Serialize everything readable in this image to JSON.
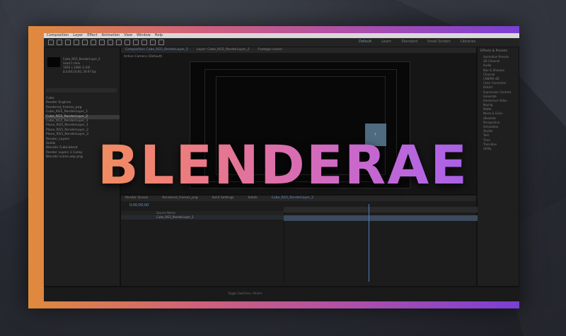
{
  "title": "BLENDERAE",
  "menubar": [
    "Composition",
    "Layer",
    "Effect",
    "Animation",
    "View",
    "Window",
    "Help"
  ],
  "workspaces": [
    "Default",
    "Learn",
    "Standard",
    "Small Screen",
    "Libraries"
  ],
  "project_panel": {
    "comp_name": "Cube_RG5_RenderLayer_2",
    "info_lines": [
      "Used 1 time",
      "1920 x 1080 (1.00)",
      "Δ 0;00;10;00, 29.97 fps"
    ],
    "items": [
      "Cube",
      "Render Engines",
      "Rendered_frames_png",
      "Cube_RG5_RenderLayer_1",
      "Cube_RG5_RenderLayer_2",
      "Cube_RG5_RenderLayer_3",
      "Plane_RG5_RenderLayer_1",
      "Plane_RG5_RenderLayer_2",
      "Plane_RG5_RenderLayer_3",
      "Render_Layers",
      "Solids",
      "Blender Cube.blend",
      "Render Layers 1 Comp",
      "Blender scene.aep.png"
    ],
    "selected_index": 4
  },
  "viewer": {
    "tabs": [
      "Composition Cube_RG5_RenderLayer_2",
      "Layer: Cube_RG5_RenderLayer_2",
      "Footage (none)"
    ],
    "active_tab": 0,
    "camera": "Active Camera (Default)"
  },
  "effects_panel": {
    "header": "Effects & Presets",
    "items": [
      "Animation Presets",
      "3D Channel",
      "Audio",
      "Blur & Sharpen",
      "Channel",
      "CINEMA 4D",
      "Color Correction",
      "Distort",
      "Expression Controls",
      "Generate",
      "Immersive Video",
      "Keying",
      "Matte",
      "Noise & Grain",
      "Obsolete",
      "Perspective",
      "Simulation",
      "Stylize",
      "Text",
      "Time",
      "Transition",
      "Utility"
    ]
  },
  "timeline": {
    "tabs": [
      "Render Queue",
      "Rendered_frames_png",
      "Solid Settings",
      "Solids",
      "Cube_RG5_RenderLayer_2"
    ],
    "active_tab": 4,
    "timecode": "0;00;00;00",
    "layer_header": "Source Name",
    "layers": [
      "Cube_RG5_RenderLayer_2"
    ]
  },
  "statusbar": "Toggle Switches / Modes"
}
